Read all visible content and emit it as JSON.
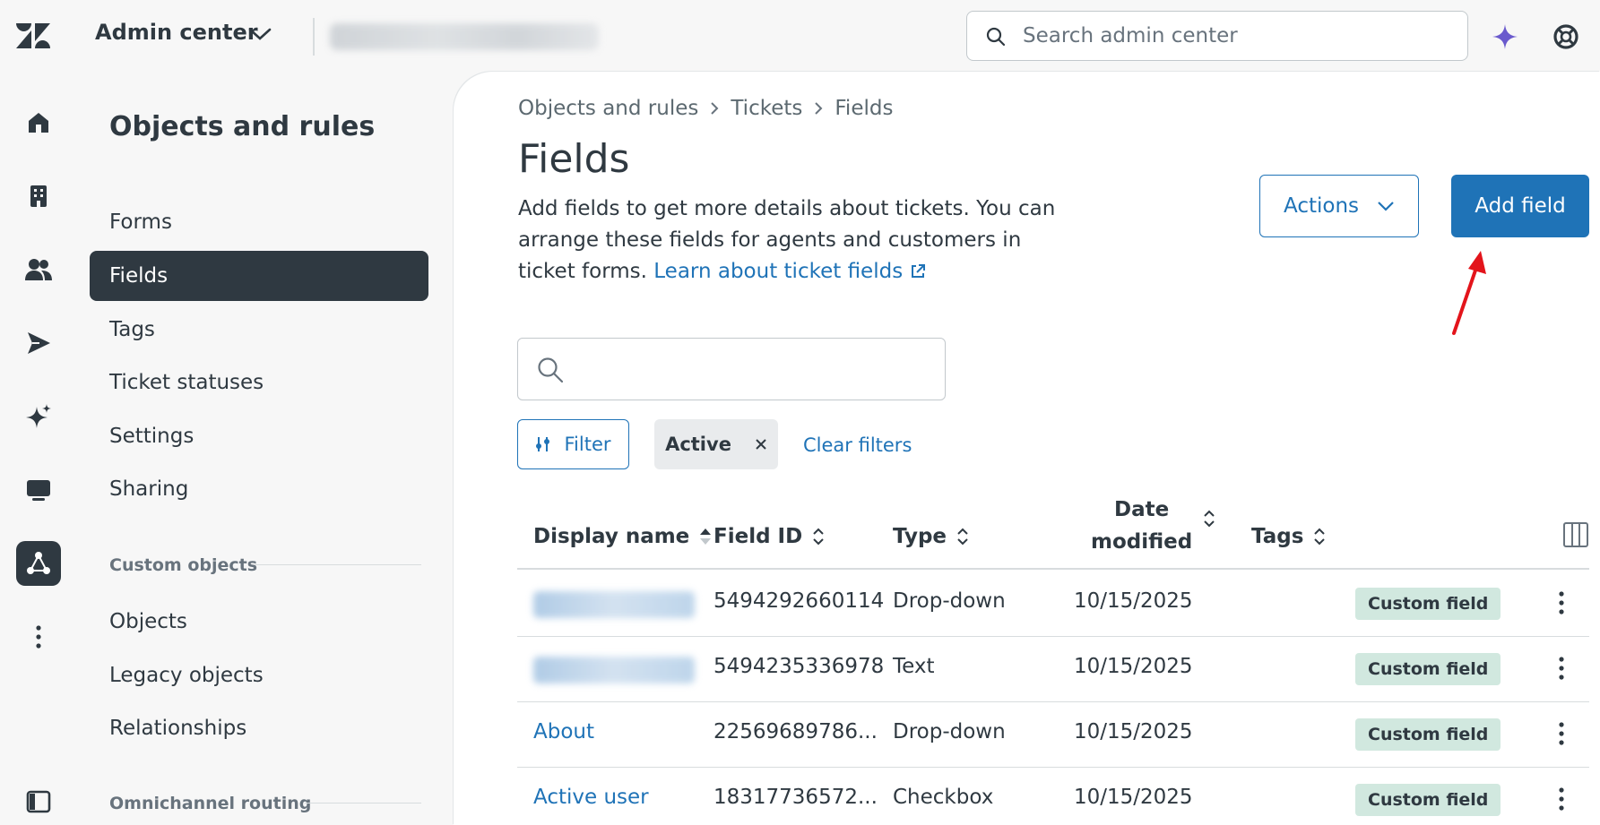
{
  "topbar": {
    "product": "Admin center",
    "search_placeholder": "Search admin center"
  },
  "rail": {
    "items": [
      "home",
      "buildings",
      "people",
      "channels",
      "ai",
      "workspaces",
      "objects-and-rules",
      "more"
    ]
  },
  "nav": {
    "title": "Objects and rules",
    "items": [
      "Forms",
      "Fields",
      "Tags",
      "Ticket statuses",
      "Settings",
      "Sharing"
    ],
    "active": "Fields",
    "section_custom": "Custom objects",
    "custom_items": [
      "Objects",
      "Legacy objects",
      "Relationships"
    ],
    "section_omni": "Omnichannel routing"
  },
  "main": {
    "breadcrumb": [
      "Objects and rules",
      "Tickets",
      "Fields"
    ],
    "title": "Fields",
    "description": "Add fields to get more details about tickets. You can arrange these fields for agents and customers in ticket forms.",
    "learn_link": "Learn about ticket fields",
    "actions_label": "Actions",
    "add_label": "Add field",
    "filter_label": "Filter",
    "active_chip": "Active",
    "clear_filters": "Clear filters"
  },
  "table": {
    "columns": [
      "Display name",
      "Field ID",
      "Type",
      "Date modified",
      "Tags"
    ],
    "date_col_line1": "Date",
    "date_col_line2": "modified",
    "rows": [
      {
        "name": "",
        "id": "5494292660114",
        "type": "Drop-down",
        "date": "10/15/2025",
        "tag": "Custom field"
      },
      {
        "name": "",
        "id": "5494235336978",
        "type": "Text",
        "date": "10/15/2025",
        "tag": "Custom field"
      },
      {
        "name": "About",
        "id": "22569689786...",
        "type": "Drop-down",
        "date": "10/15/2025",
        "tag": "Custom field"
      },
      {
        "name": "Active user",
        "id": "18317736572...",
        "type": "Checkbox",
        "date": "10/15/2025",
        "tag": "Custom field"
      }
    ]
  },
  "colors": {
    "accent": "#1f73b7",
    "dark": "#2f3941",
    "tag_bg": "#d1e8df",
    "annotation_arrow": "#e3141b",
    "ai_star": "#6a5acd"
  }
}
